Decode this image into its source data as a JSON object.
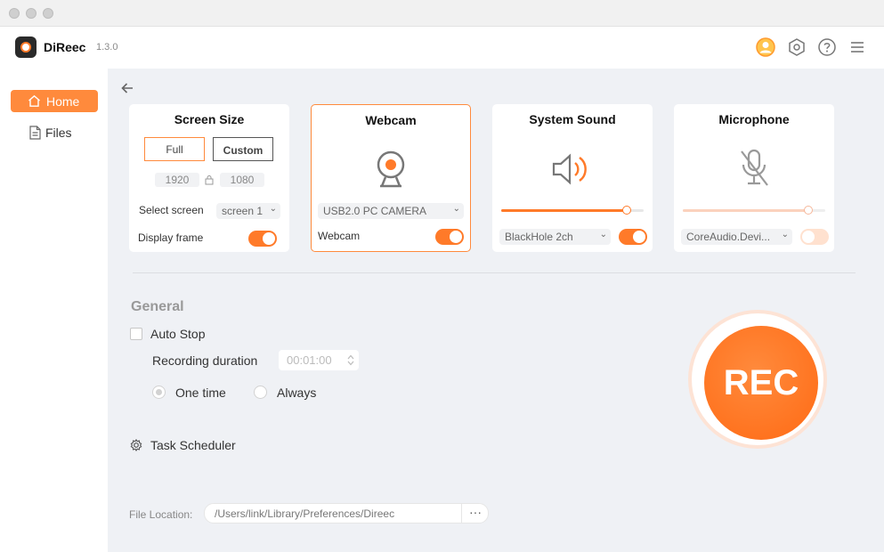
{
  "app": {
    "name": "DiReec",
    "version": "1.3.0"
  },
  "sidebar": {
    "items": [
      {
        "label": "Home",
        "active": true
      },
      {
        "label": "Files",
        "active": false
      }
    ]
  },
  "cards": {
    "screen_size": {
      "title": "Screen Size",
      "full_label": "Full",
      "custom_label": "Custom",
      "width": "1920",
      "height": "1080",
      "select_screen_label": "Select screen",
      "select_screen_value": "screen 1",
      "display_frame_label": "Display frame",
      "display_frame_on": true
    },
    "webcam": {
      "title": "Webcam",
      "device": "USB2.0 PC CAMERA",
      "toggle_label": "Webcam",
      "on": true
    },
    "system_sound": {
      "title": "System Sound",
      "device": "BlackHole 2ch",
      "volume": 0.88,
      "on": true
    },
    "microphone": {
      "title": "Microphone",
      "device": "CoreAudio.Devi...",
      "volume": 0.88,
      "on": false
    }
  },
  "general": {
    "title": "General",
    "auto_stop_label": "Auto Stop",
    "recording_duration_label": "Recording duration",
    "recording_duration_value": "00:01:00",
    "one_time_label": "One time",
    "always_label": "Always",
    "task_scheduler_label": "Task Scheduler",
    "file_location_label": "File Location:",
    "file_location_value": "/Users/link/Library/Preferences/Direec",
    "file_location_button": "···"
  },
  "rec_button": {
    "label": "REC"
  },
  "colors": {
    "accent": "#ff7a29",
    "accent_light": "#fde3d5",
    "background": "#eff1f5"
  }
}
